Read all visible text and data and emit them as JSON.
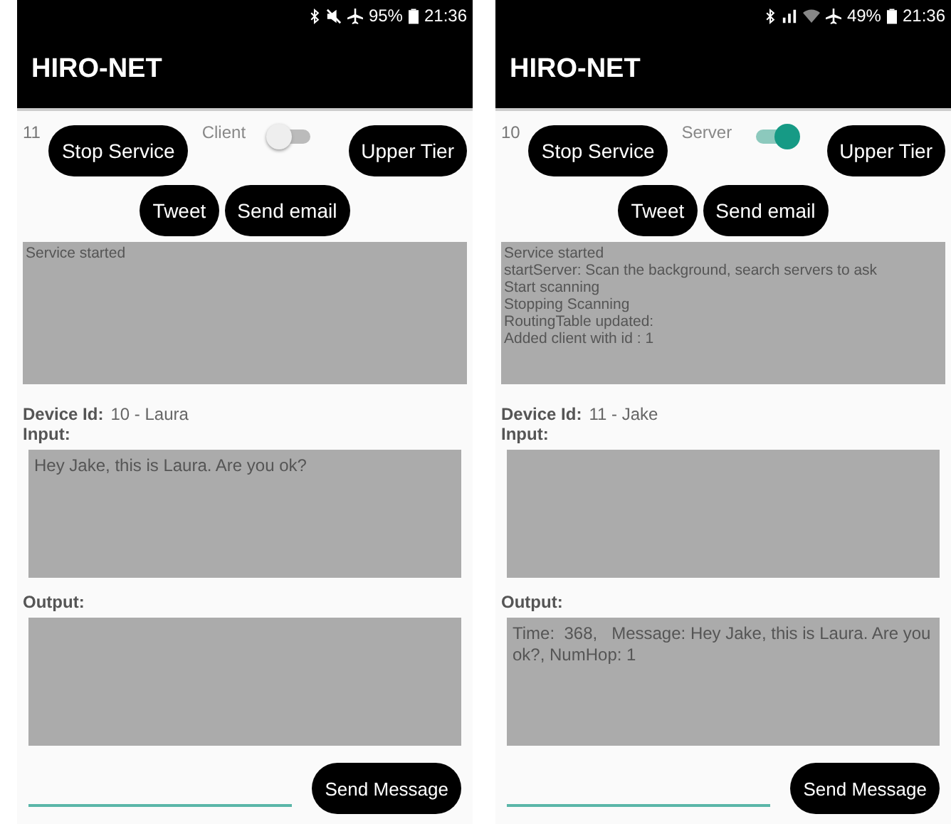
{
  "phones": [
    {
      "status_bar": {
        "icons": [
          {
            "kind": "bluetooth"
          },
          {
            "kind": "mute"
          },
          {
            "kind": "airplane"
          }
        ],
        "battery": "95%",
        "time": "21:36"
      },
      "app_title": "HIRO-NET",
      "node_count": "11",
      "stop_button": "Stop Service",
      "role_label": "Client",
      "role_switch_on": false,
      "upper_tier_button": "Upper Tier",
      "tweet_button": "Tweet",
      "email_button": "Send email",
      "log": [
        "Service started"
      ],
      "device_id_label": "Device Id:",
      "device_id": "10 - Laura",
      "input_label": "Input:",
      "input_value": "Hey Jake, this is Laura. Are you ok?",
      "output_label": "Output:",
      "send_button": "Send Message"
    },
    {
      "status_bar": {
        "icons": [
          {
            "kind": "bluetooth"
          },
          {
            "kind": "signal"
          },
          {
            "kind": "wifi"
          },
          {
            "kind": "airplane"
          }
        ],
        "battery": "49%",
        "time": "21:36"
      },
      "app_title": "HIRO-NET",
      "node_count": "10",
      "stop_button": "Stop Service",
      "role_label": "Server",
      "role_switch_on": true,
      "upper_tier_button": "Upper Tier",
      "tweet_button": "Tweet",
      "email_button": "Send email",
      "log": [
        "Service started",
        "startServer: Scan the background, search servers to ask",
        "Start scanning",
        "Stopping Scanning",
        "RoutingTable updated:",
        "Added client with id : 1"
      ],
      "device_id_label": "Device Id:",
      "device_id": "11 - Jake",
      "input_label": "Input:",
      "output_label": "Output:",
      "output_value": "Time:  368,   Message: Hey Jake, this is Laura. Are you ok?, NumHop: 1",
      "send_button": "Send Message"
    }
  ]
}
